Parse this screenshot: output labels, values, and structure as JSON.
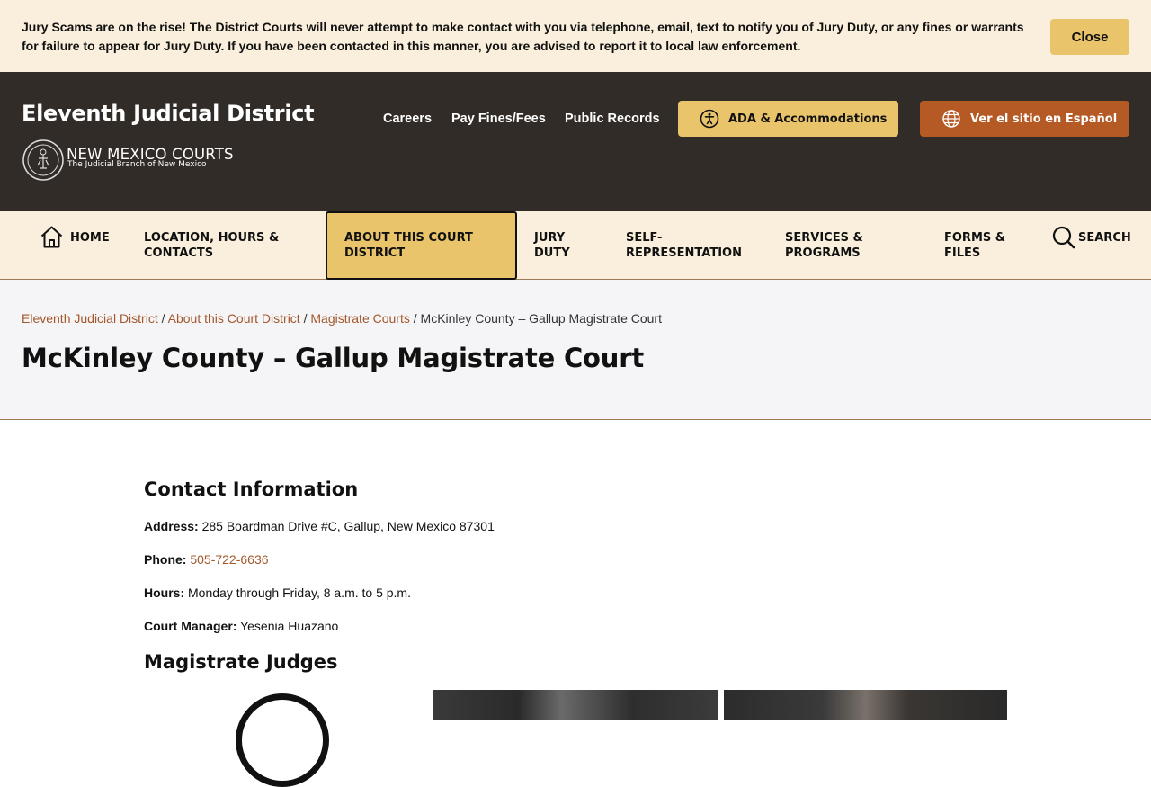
{
  "alert": {
    "message": "Jury Scams are on the rise! The District Courts will never attempt to make contact with you via telephone, email, text to notify you of Jury Duty, or any fines or warrants for failure to appear for Jury Duty. If you have been contacted in this manner, you are advised to report it to local law enforcement.",
    "close_label": "Close"
  },
  "header": {
    "site_title": "Eleventh Judicial District",
    "logo_title": "NEW MEXICO COURTS",
    "logo_subtitle": "The Judicial Branch of New Mexico",
    "links": [
      "Careers",
      "Pay Fines/Fees",
      "Public Records"
    ],
    "ada_label": "ADA & Accommodations",
    "spanish_label": "Ver el sitio en Español"
  },
  "nav": {
    "home": "HOME",
    "location": "LOCATION, HOURS & CONTACTS",
    "about": "ABOUT THIS COURT DISTRICT",
    "jury": "JURY DUTY",
    "self_rep": "SELF-REPRESENTATION",
    "services": "SERVICES & PROGRAMS",
    "forms": "FORMS & FILES",
    "search": "SEARCH"
  },
  "breadcrumb": {
    "items": [
      "Eleventh Judicial District",
      "About this Court District",
      "Magistrate Courts"
    ],
    "current": "McKinley County – Gallup Magistrate Court",
    "separator": "/"
  },
  "page": {
    "title": "McKinley County – Gallup Magistrate Court"
  },
  "contact": {
    "heading": "Contact Information",
    "address_label": "Address:",
    "address": "285 Boardman Drive #C, Gallup, New Mexico 87301",
    "phone_label": "Phone:",
    "phone": "505-722-6636",
    "hours_label": "Hours:",
    "hours": "Monday through Friday, 8 a.m. to 5 p.m.",
    "manager_label": "Court Manager:",
    "manager": "Yesenia Huazano"
  },
  "judges": {
    "heading": "Magistrate Judges"
  },
  "colors": {
    "banner_bg": "#f9efdc",
    "header_bg": "#312c27",
    "accent_gold": "#e9c46a",
    "accent_orange": "#b65a25",
    "link": "#a3572a"
  }
}
